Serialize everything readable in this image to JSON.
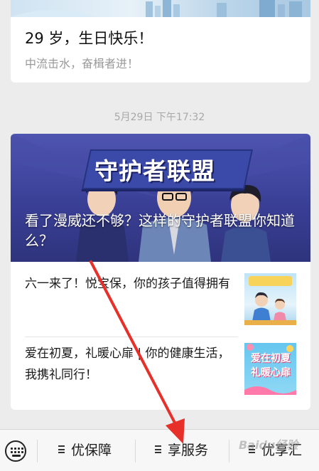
{
  "feed": {
    "birthday_card": {
      "title": "29 岁，生日快乐！",
      "subtitle": "中流击水，奋楫者进！"
    },
    "timestamp": "5月29日 下午17:32",
    "article_card": {
      "hero_banner_text": "守护者联盟",
      "hero_title": "看了漫威还不够？这样的守护者联盟你知道么？",
      "items": [
        {
          "title": "六一来了！悦宝保，你的孩子值得拥有",
          "thumb_icon": "children-illustration"
        },
        {
          "title": "爱在初夏，礼暖心扉 | 你的健康生活，我携礼同行！",
          "thumb_text": "爱在初夏 礼暖心扉"
        }
      ]
    }
  },
  "menu_bar": {
    "keyboard_icon": "keyboard-icon",
    "items": [
      {
        "label": "优保障"
      },
      {
        "label": "享服务"
      },
      {
        "label": "优享汇"
      }
    ]
  },
  "watermark": "Baidu经验",
  "colors": {
    "hero_bg": "#3a3f96",
    "page_bg": "#ececec",
    "arrow": "#e8302b"
  }
}
